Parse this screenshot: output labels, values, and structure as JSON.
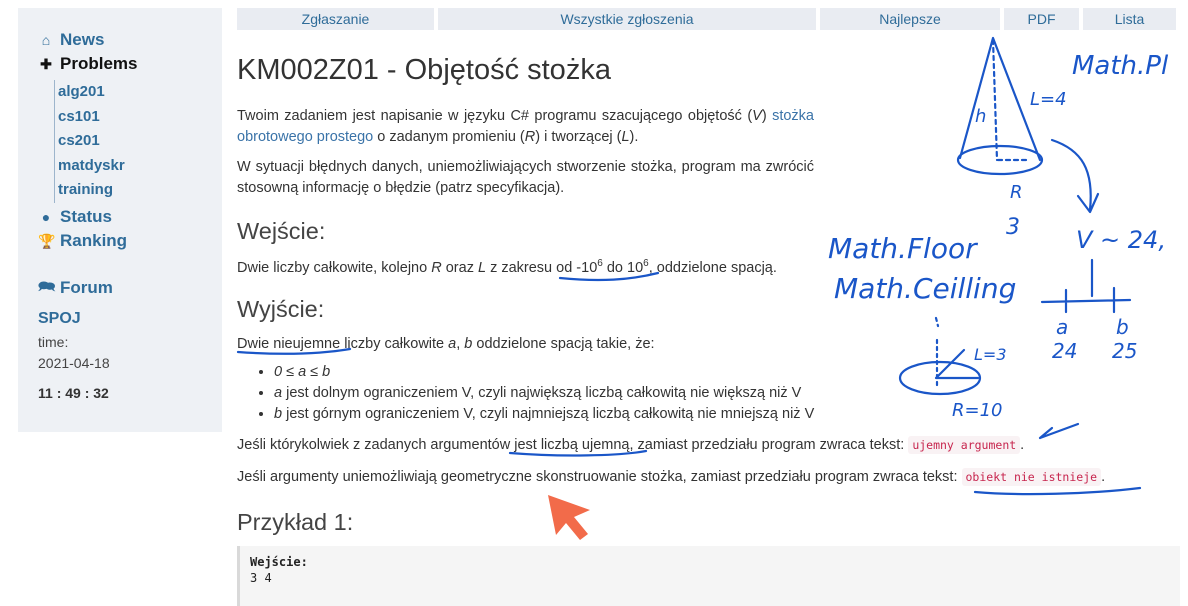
{
  "sidebar": {
    "news": "News",
    "problems": "Problems",
    "sub_items": [
      "alg201",
      "cs101",
      "cs201",
      "matdyskr",
      "training"
    ],
    "status": "Status",
    "ranking": "Ranking",
    "forum": "Forum",
    "spoj": "SPOJ",
    "time_label": "time:",
    "date": "2021-04-18",
    "clock": "11 : 49 : 32"
  },
  "tabs": [
    "Zgłaszanie",
    "Wszystkie zgłoszenia",
    "Najlepsze",
    "PDF",
    "Lista"
  ],
  "problem": {
    "title": "KM002Z01 - Objętość stożka",
    "intro_a": "Twoim zadaniem jest napisanie w języku C# programu szacującego objętość (",
    "intro_v": "V",
    "intro_b": ") ",
    "intro_link": "stożka obrotowego prostego",
    "intro_c": " o zadanym promieniu (",
    "intro_r": "R",
    "intro_d": ") i tworzącej (",
    "intro_l": "L",
    "intro_e": ").",
    "error_para": "W sytuacji błędnych danych, uniemożliwiających stworzenie stożka, program ma zwrócić stosowną informację o błędzie (patrz specyfikacja).",
    "input_heading": "Wejście:",
    "input_a": "Dwie liczby całkowite, kolejno ",
    "input_r": "R",
    "input_b": " oraz ",
    "input_l": "L",
    "input_c": " z zakresu od -10",
    "input_exp1": "6",
    "input_d": " do 10",
    "input_exp2": "6",
    "input_e": ", oddzielone spacją.",
    "output_heading": "Wyjście:",
    "output_a": "Dwie nieujemne liczby całkowite ",
    "output_av": "a",
    "output_b": ", ",
    "output_bv": "b",
    "output_c": " oddzielone spacją takie, że:",
    "bullet1": "0 ≤ a ≤ b",
    "bullet2_var": "a",
    "bullet2": " jest dolnym ograniczeniem V, czyli największą liczbą całkowitą nie większą niż V",
    "bullet3_var": "b",
    "bullet3": " jest górnym ograniczeniem V, czyli najmniejszą liczbą całkowitą nie mniejszą niż V",
    "neg_line": "Jeśli którykolwiek z zadanych argumentów jest liczbą ujemną, zamiast przedziału program zwraca tekst: ",
    "neg_code": "ujemny argument",
    "geo_line": "Jeśli argumenty uniemożliwiają geometryczne skonstruowanie stożka, zamiast przedziału program zwraca tekst: ",
    "geo_code": "obiekt nie istnieje",
    "example_heading": "Przykład 1:",
    "example_label": "Wejście:",
    "example_value": "3 4"
  },
  "annotations": {
    "mathpl": "Math.Pl",
    "floor": "Math.Floor",
    "ceiling": "Math.Ceilling",
    "h": "h",
    "l4": "L=4",
    "r": "R",
    "r3": "3",
    "v_approx": "V ~ 24,",
    "a": "a",
    "b": "b",
    "a_val": "24",
    "b_val": "25",
    "l3": "L=3",
    "r10": "R=10"
  },
  "colors": {
    "link": "#2f6c99",
    "ink": "#1a56c8",
    "cursor": "#f26b4a",
    "code": "#c7254e"
  }
}
